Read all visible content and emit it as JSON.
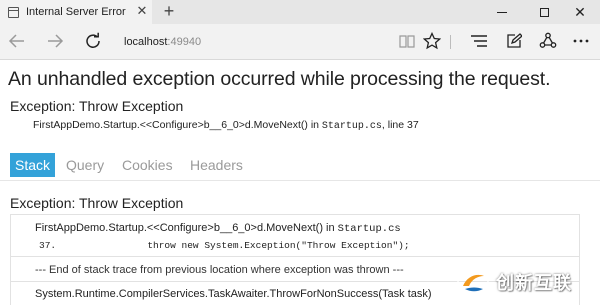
{
  "browser": {
    "tab_title": "Internal Server Error",
    "tab_close_icon": "close-icon",
    "new_tab_icon": "plus-icon",
    "address_host": "localhost",
    "address_port": ":49940",
    "icons": {
      "back": "arrow-left-icon",
      "forward": "arrow-right-icon",
      "refresh": "refresh-icon",
      "reading_view": "book-icon",
      "favorite": "star-icon",
      "hub": "hub-icon",
      "web_note": "pen-square-icon",
      "share": "share-icon",
      "more": "ellipsis-icon"
    }
  },
  "page": {
    "heading": "An unhandled exception occurred while processing the request.",
    "exception_title": "Exception: Throw Exception",
    "exception_location": {
      "method": "FirstAppDemo.Startup.<<Configure>b__6_0>d.MoveNext() in ",
      "file": "Startup.cs",
      "line_text": ", line 37"
    },
    "tabs": [
      {
        "label": "Stack",
        "active": true
      },
      {
        "label": "Query",
        "active": false
      },
      {
        "label": "Cookies",
        "active": false
      },
      {
        "label": "Headers",
        "active": false
      }
    ],
    "stack_exception_title": "Exception: Throw Exception",
    "frames": {
      "first": {
        "method": "FirstAppDemo.Startup.<<Configure>b__6_0>d.MoveNext() in ",
        "file": "Startup.cs",
        "code_line": "37.                throw new System.Exception(\"Throw Exception\");"
      },
      "separator": "--- End of stack trace from previous location where exception was thrown ---",
      "next": "System.Runtime.CompilerServices.TaskAwaiter.ThrowForNonSuccess(Task task)"
    }
  },
  "watermark": {
    "text": "创新互联",
    "colors": {
      "orange": "#f39a1e",
      "blue": "#1f6fb8"
    }
  },
  "colors": {
    "active_tab": "#33a2d9",
    "inactive_tab_text": "#9a9a9a"
  }
}
